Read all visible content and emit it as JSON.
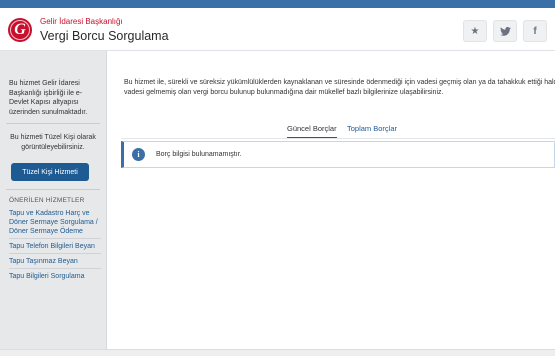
{
  "header": {
    "org": "Gelir İdaresi Başkanlığı",
    "title": "Vergi Borcu Sorgulama",
    "logo_letter": "G",
    "social": [
      {
        "icon": "star-icon",
        "glyph": "★"
      },
      {
        "icon": "twitter-icon",
        "glyph": "🐦"
      },
      {
        "icon": "facebook-icon",
        "glyph": "f"
      }
    ]
  },
  "sidebar": {
    "info": "Bu hizmet Gelir İdaresi Başkanlığı işbirliği ile e-Devlet Kapısı altyapısı üzerinden sunulmaktadır.",
    "note": "Bu hizmeti Tüzel Kişi olarak görüntüleyebilirsiniz.",
    "button_label": "Tüzel Kişi Hizmeti",
    "recommended_title": "ÖNERİLEN HİZMETLER",
    "links": [
      "Tapu ve Kadastro Harç ve Döner Sermaye Sorgulama / Döner Sermaye Ödeme",
      "Tapu Telefon Bilgileri Beyan",
      "Tapu Taşınmaz Beyan",
      "Tapu Bilgileri Sorgulama"
    ]
  },
  "main": {
    "description": "Bu hizmet ile, sürekli ve süreksiz yükümlülüklerden kaynaklanan ve süresinde ödenmediği için vadesi geçmiş olan ya da tahakkuk ettiği halde vadesi gelmemiş olan vergi borcu bulunup bulunmadığına dair mükellef bazlı bilgilerinize ulaşabilirsiniz.",
    "tabs": [
      "Güncel Borçlar",
      "Toplam Borçlar"
    ],
    "alert_text": "Borç bilgisi bulunamamıştır.",
    "alert_icon": "i"
  },
  "colors": {
    "brand_red": "#c8102e",
    "accent_blue": "#1f5b93",
    "top_bar": "#3b6fa8"
  }
}
